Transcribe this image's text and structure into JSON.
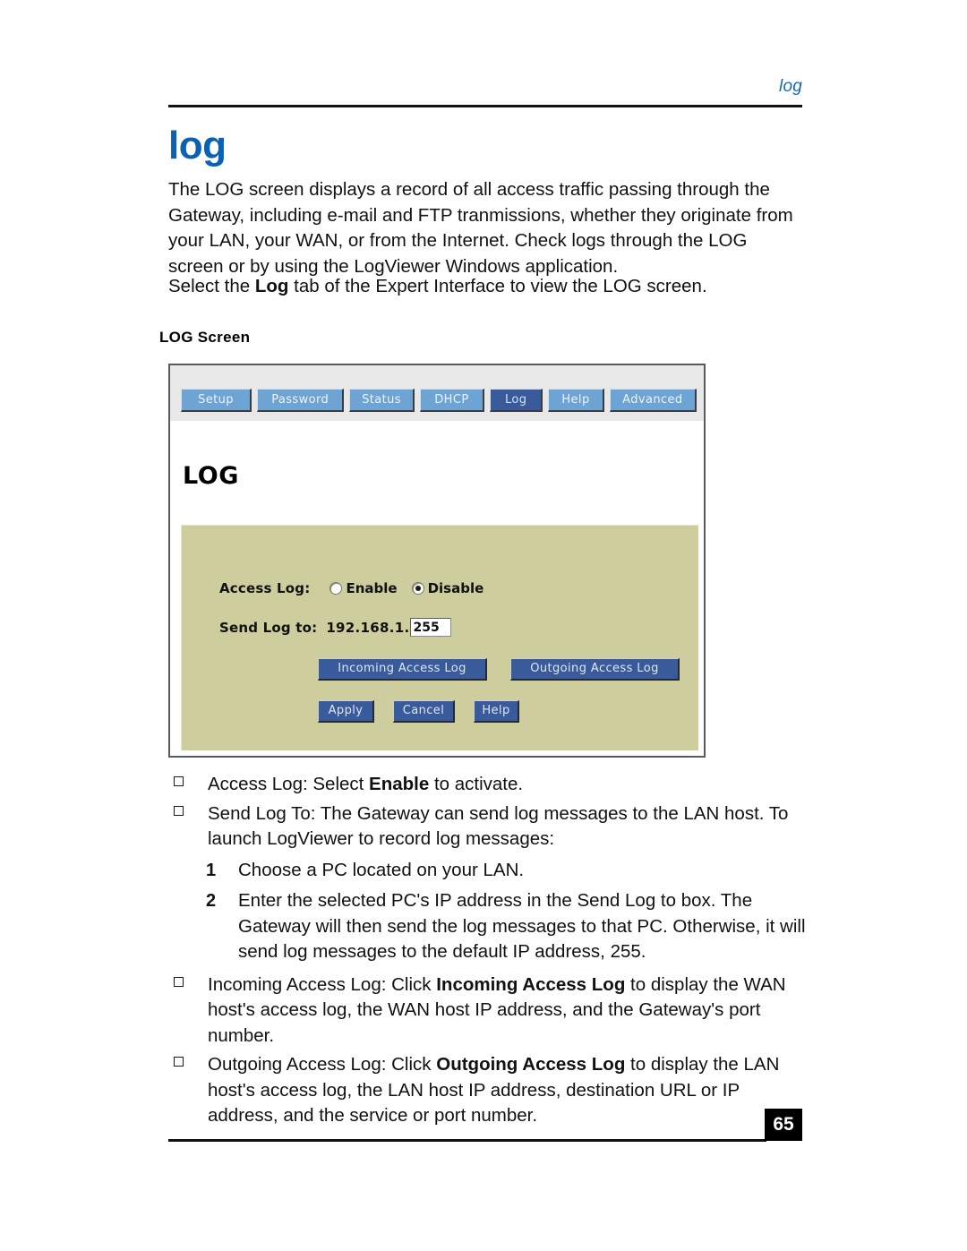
{
  "header": {
    "running_title": "log"
  },
  "page_title": "log",
  "paragraphs": {
    "intro": "The LOG screen displays a record of all access traffic passing through the Gateway, including e-mail and FTP tranmissions, whether they originate from your LAN, your WAN, or from the Internet. Check logs through the LOG screen or by using the LogViewer Windows application.",
    "select_prefix": "Select the ",
    "select_bold": "Log",
    "select_suffix": " tab of the Expert Interface to view the LOG screen."
  },
  "figure_caption": "LOG Screen",
  "screenshot": {
    "tabs": [
      {
        "label": "Setup",
        "active": false
      },
      {
        "label": "Password",
        "active": false
      },
      {
        "label": "Status",
        "active": false
      },
      {
        "label": "DHCP",
        "active": false
      },
      {
        "label": "Log",
        "active": true
      },
      {
        "label": "Help",
        "active": false
      },
      {
        "label": "Advanced",
        "active": false
      }
    ],
    "heading": "LOG",
    "access_log": {
      "label": "Access Log:",
      "options": [
        {
          "label": "Enable",
          "selected": false
        },
        {
          "label": "Disable",
          "selected": true
        }
      ]
    },
    "send_log": {
      "label": "Send Log to:",
      "ip_prefix": "192.168.1.",
      "value": "255"
    },
    "buttons": {
      "incoming": "Incoming Access Log",
      "outgoing": "Outgoing Access Log",
      "apply": "Apply",
      "cancel": "Cancel",
      "help": "Help"
    },
    "colors": {
      "tab_inactive": "#6ea4d4",
      "tab_active": "#3a5b9b",
      "panel": "#cdcd9e",
      "button": "#3a5b9b",
      "tabbar": "#e8e8e8"
    }
  },
  "bullets": {
    "access_log": {
      "prefix": "Access Log:  Select ",
      "bold": "Enable",
      "suffix": " to activate."
    },
    "send_log_to": "Send Log To:  The Gateway can send log messages to the LAN host. To launch LogViewer to record log messages:",
    "step1": {
      "number": "1",
      "text": "Choose a PC located on your LAN."
    },
    "step2": {
      "number": "2",
      "text": "Enter the selected PC's IP address in the Send Log to box. The Gateway will then send the log messages to that PC. Otherwise, it will send log messages to the default IP address, 255."
    },
    "incoming": {
      "prefix": "Incoming Access Log:  Click ",
      "bold": "Incoming Access Log",
      "suffix": " to display the WAN host's access log, the WAN host IP address, and the Gateway's port number."
    },
    "outgoing": {
      "prefix": "Outgoing Access Log:  Click ",
      "bold": "Outgoing Access Log",
      "suffix": " to display the LAN host's access log, the LAN host IP address, destination URL or IP address, and the service or port number."
    }
  },
  "footer": {
    "page_number": "65"
  }
}
